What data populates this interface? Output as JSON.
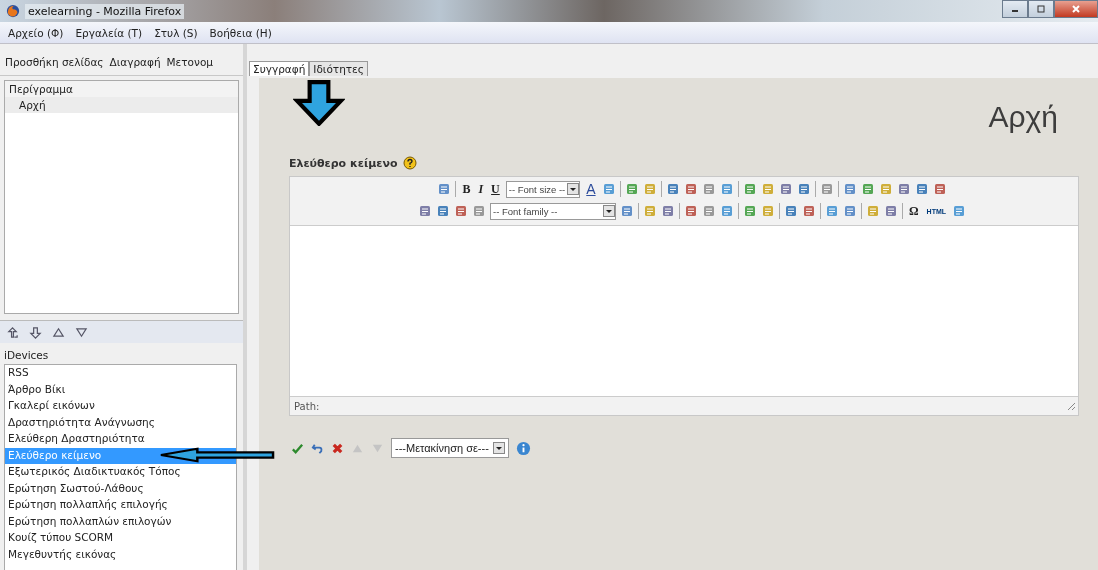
{
  "window": {
    "title": "exelearning - Mozilla Firefox"
  },
  "menu": [
    {
      "label": "Αρχείο (Φ)"
    },
    {
      "label": "Εργαλεία (Τ)"
    },
    {
      "label": "Στυλ (S)"
    },
    {
      "label": "Βοήθεια (Η)"
    }
  ],
  "outline_toolbar": [
    "Προσθήκη σελίδας",
    "Διαγραφή",
    "Μετονομ"
  ],
  "outline": {
    "header": "Περίγραμμα",
    "items": [
      {
        "label": "Αρχή",
        "selected": true
      }
    ]
  },
  "idevices": {
    "title": "iDevices",
    "items": [
      {
        "label": "RSS",
        "selected": false
      },
      {
        "label": "Άρθρο Βίκι",
        "selected": false
      },
      {
        "label": "Γκαλερί εικόνων",
        "selected": false
      },
      {
        "label": "Δραστηριότητα Ανάγνωσης",
        "selected": false
      },
      {
        "label": "Ελεύθερη Δραστηριότητα",
        "selected": false
      },
      {
        "label": "Ελεύθερο κείμενο",
        "selected": true
      },
      {
        "label": "Εξωτερικός Διαδικτυακός Τόπος",
        "selected": false
      },
      {
        "label": "Ερώτηση Σωστού-Λάθους",
        "selected": false
      },
      {
        "label": "Ερώτηση πολλαπλής επιλογής",
        "selected": false
      },
      {
        "label": "Ερώτηση πολλαπλών επιλογών",
        "selected": false
      },
      {
        "label": "Κουίζ τύπου SCORM",
        "selected": false
      },
      {
        "label": "Μεγεθυντής εικόνας",
        "selected": false
      }
    ]
  },
  "tabs": [
    {
      "label": "Συγγραφή",
      "selected": true
    },
    {
      "label": "Ιδιότητες",
      "selected": false
    }
  ],
  "page_title": "Αρχή",
  "idevice_label": "Ελεύθερο κείμενο",
  "editor": {
    "toolbar_rows": [
      [
        {
          "kind": "icon"
        },
        {
          "kind": "sep"
        },
        {
          "kind": "bold",
          "label": "B"
        },
        {
          "kind": "italic",
          "label": "I"
        },
        {
          "kind": "underline",
          "label": "U"
        },
        {
          "kind": "select",
          "label": "-- Font size --"
        },
        {
          "kind": "color",
          "label": "A"
        },
        {
          "kind": "icon"
        },
        {
          "kind": "sep"
        },
        {
          "kind": "icon"
        },
        {
          "kind": "icon"
        },
        {
          "kind": "sep"
        },
        {
          "kind": "icon"
        },
        {
          "kind": "icon"
        },
        {
          "kind": "icon"
        },
        {
          "kind": "icon"
        },
        {
          "kind": "sep"
        },
        {
          "kind": "icon"
        },
        {
          "kind": "icon"
        },
        {
          "kind": "icon"
        },
        {
          "kind": "icon"
        },
        {
          "kind": "sep"
        },
        {
          "kind": "icon"
        },
        {
          "kind": "sep"
        },
        {
          "kind": "icon"
        },
        {
          "kind": "icon"
        },
        {
          "kind": "icon"
        },
        {
          "kind": "icon"
        },
        {
          "kind": "icon"
        },
        {
          "kind": "icon"
        }
      ],
      [
        {
          "kind": "icon"
        },
        {
          "kind": "icon"
        },
        {
          "kind": "icon"
        },
        {
          "kind": "icon"
        },
        {
          "kind": "select",
          "label": "-- Font family --"
        },
        {
          "kind": "icon"
        },
        {
          "kind": "sep"
        },
        {
          "kind": "icon"
        },
        {
          "kind": "icon"
        },
        {
          "kind": "sep"
        },
        {
          "kind": "icon"
        },
        {
          "kind": "icon"
        },
        {
          "kind": "icon"
        },
        {
          "kind": "sep"
        },
        {
          "kind": "icon"
        },
        {
          "kind": "icon"
        },
        {
          "kind": "sep"
        },
        {
          "kind": "icon"
        },
        {
          "kind": "icon"
        },
        {
          "kind": "sep"
        },
        {
          "kind": "icon"
        },
        {
          "kind": "icon"
        },
        {
          "kind": "sep"
        },
        {
          "kind": "icon"
        },
        {
          "kind": "icon"
        },
        {
          "kind": "sep"
        },
        {
          "kind": "symbol",
          "label": "Ω"
        },
        {
          "kind": "html",
          "label": "HTML"
        },
        {
          "kind": "icon"
        }
      ]
    ],
    "path_label": "Path:"
  },
  "move_select": "---Μετακίνηση σε---"
}
